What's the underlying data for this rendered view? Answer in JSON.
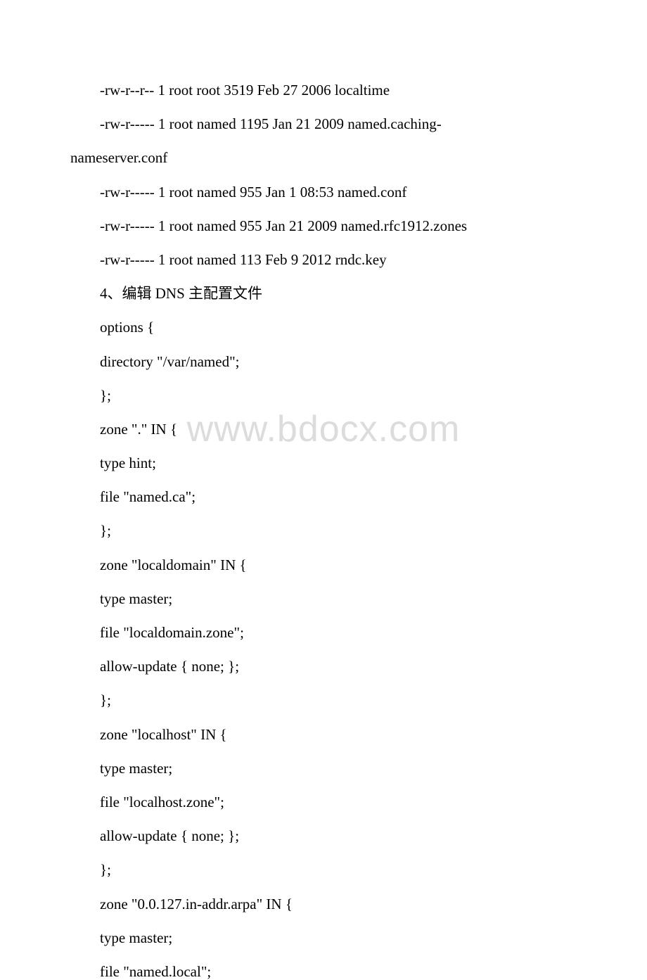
{
  "watermark": "www.bdocx.com",
  "lines": [
    {
      "text": "-rw-r--r-- 1 root root 3519 Feb 27 2006 localtime",
      "indent": true
    },
    {
      "text": "-rw-r----- 1 root named 1195 Jan 21 2009 named.caching-",
      "indent": true
    },
    {
      "text": "nameserver.conf",
      "indent": false,
      "wrap": true
    },
    {
      "text": "-rw-r----- 1 root named 955 Jan 1 08:53 named.conf",
      "indent": true
    },
    {
      "text": "-rw-r----- 1 root named 955 Jan 21 2009 named.rfc1912.zones",
      "indent": true
    },
    {
      "text": "-rw-r----- 1 root named 113 Feb 9 2012 rndc.key",
      "indent": true
    },
    {
      "text": "4、编辑 DNS 主配置文件",
      "indent": true
    },
    {
      "text": "options {",
      "indent": true
    },
    {
      "text": " directory \"/var/named\";",
      "indent": true
    },
    {
      "text": "};",
      "indent": true
    },
    {
      "text": "zone \".\" IN {",
      "indent": true
    },
    {
      "text": " type hint;",
      "indent": true
    },
    {
      "text": " file \"named.ca\";",
      "indent": true
    },
    {
      "text": "};",
      "indent": true
    },
    {
      "text": "zone \"localdomain\" IN {",
      "indent": true
    },
    {
      "text": " type master;",
      "indent": true
    },
    {
      "text": " file \"localdomain.zone\";",
      "indent": true
    },
    {
      "text": " allow-update { none; };",
      "indent": true
    },
    {
      "text": "};",
      "indent": true
    },
    {
      "text": "zone \"localhost\" IN {",
      "indent": true
    },
    {
      "text": " type master;",
      "indent": true
    },
    {
      "text": " file \"localhost.zone\";",
      "indent": true
    },
    {
      "text": " allow-update { none; };",
      "indent": true
    },
    {
      "text": "};",
      "indent": true
    },
    {
      "text": "zone \"0.0.127.in-addr.arpa\" IN {",
      "indent": true
    },
    {
      "text": " type master;",
      "indent": true
    },
    {
      "text": " file \"named.local\";",
      "indent": true
    }
  ]
}
